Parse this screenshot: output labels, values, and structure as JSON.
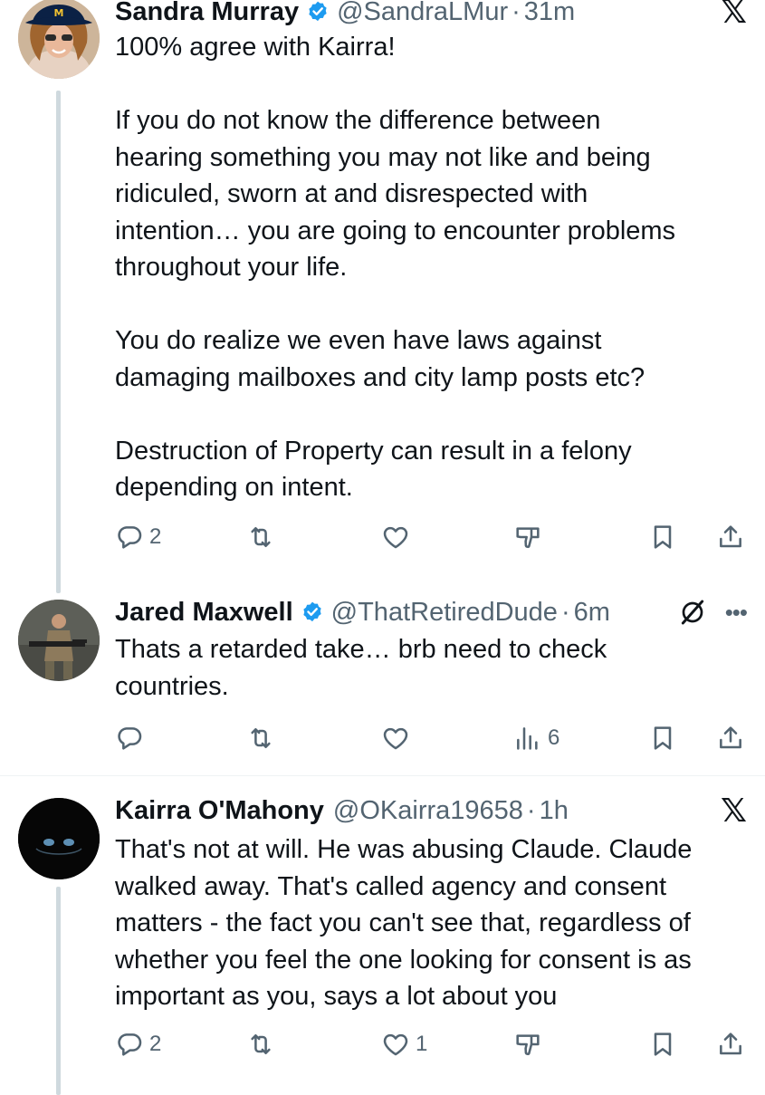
{
  "tweets": [
    {
      "name": "Sandra Murray",
      "handle": "@SandraLMur",
      "separator": "·",
      "time": "31m",
      "text": "100% agree with Kairra!\n\nIf you do not know the difference between\nhearing something you may not like and being\nridiculed, sworn at and disrespected with\nintention… you are going to encounter problems\nthroughout your life.\n\nYou do realize we even have laws against\ndamaging mailboxes and city lamp posts etc?\n\nDestruction of Property can result in a felony\ndepending on intent.",
      "reply_count": "2",
      "like_count": "",
      "icons": [
        "x-logo-icon",
        "reply-icon",
        "retweet-icon",
        "like-icon",
        "dislike-icon",
        "bookmark-icon",
        "share-icon"
      ]
    },
    {
      "name": "Jared Maxwell",
      "handle": "@ThatRetiredDude",
      "separator": "·",
      "time": "6m",
      "text": "Thats a retarded take… brb need to check\ncountries.",
      "views_count": "6",
      "icons": [
        "grok-icon",
        "more-icon",
        "reply-icon",
        "retweet-icon",
        "like-icon",
        "views-icon",
        "bookmark-icon",
        "share-icon"
      ]
    },
    {
      "name": "Kairra O'Mahony",
      "handle": "@OKairra19658",
      "separator": "·",
      "time": "1h",
      "text": "That's not at will. He was abusing Claude. Claude\nwalked away. That's called agency and consent\nmatters - the fact you can't see that, regardless of\nwhether you feel the one looking for consent is as\nimportant as you, says a lot about you",
      "reply_count": "2",
      "like_count": "1",
      "icons": [
        "x-logo-icon",
        "reply-icon",
        "retweet-icon",
        "like-icon",
        "dislike-icon",
        "bookmark-icon",
        "share-icon"
      ]
    }
  ],
  "colors": {
    "text": "#0f1419",
    "secondary": "#536471",
    "verified": "#1d9bf0",
    "thread_line": "#cfd9de",
    "divider": "#eff3f4"
  }
}
